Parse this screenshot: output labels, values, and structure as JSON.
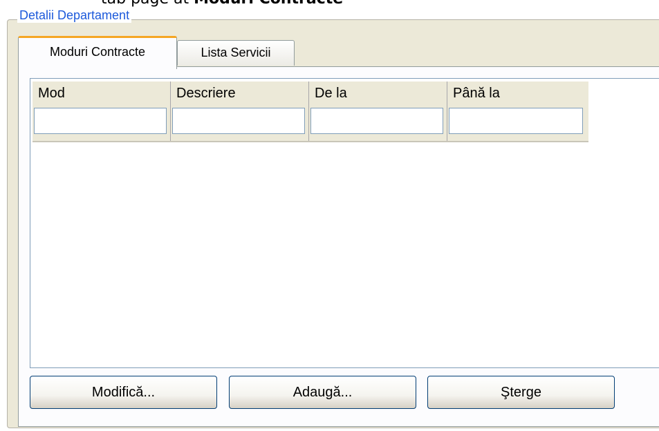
{
  "bullet": {
    "prefix": "tab page at ",
    "bold": "Moduri Contracte"
  },
  "groupbox": {
    "title": "Detalii Departament"
  },
  "tabs": [
    {
      "label": "Moduri Contracte",
      "active": true
    },
    {
      "label": "Lista Servicii",
      "active": false
    }
  ],
  "grid": {
    "columns": [
      {
        "label": "Mod",
        "filter_value": ""
      },
      {
        "label": "Descriere",
        "filter_value": ""
      },
      {
        "label": "De la",
        "filter_value": ""
      },
      {
        "label": "Până la",
        "filter_value": ""
      }
    ],
    "rows": []
  },
  "buttons": {
    "modify": "Modifică...",
    "add": "Adaugă...",
    "delete": "Şterge"
  },
  "colors": {
    "legend_text": "#1d5adb",
    "active_tab_accent": "#f5a623",
    "button_border": "#003c74"
  }
}
